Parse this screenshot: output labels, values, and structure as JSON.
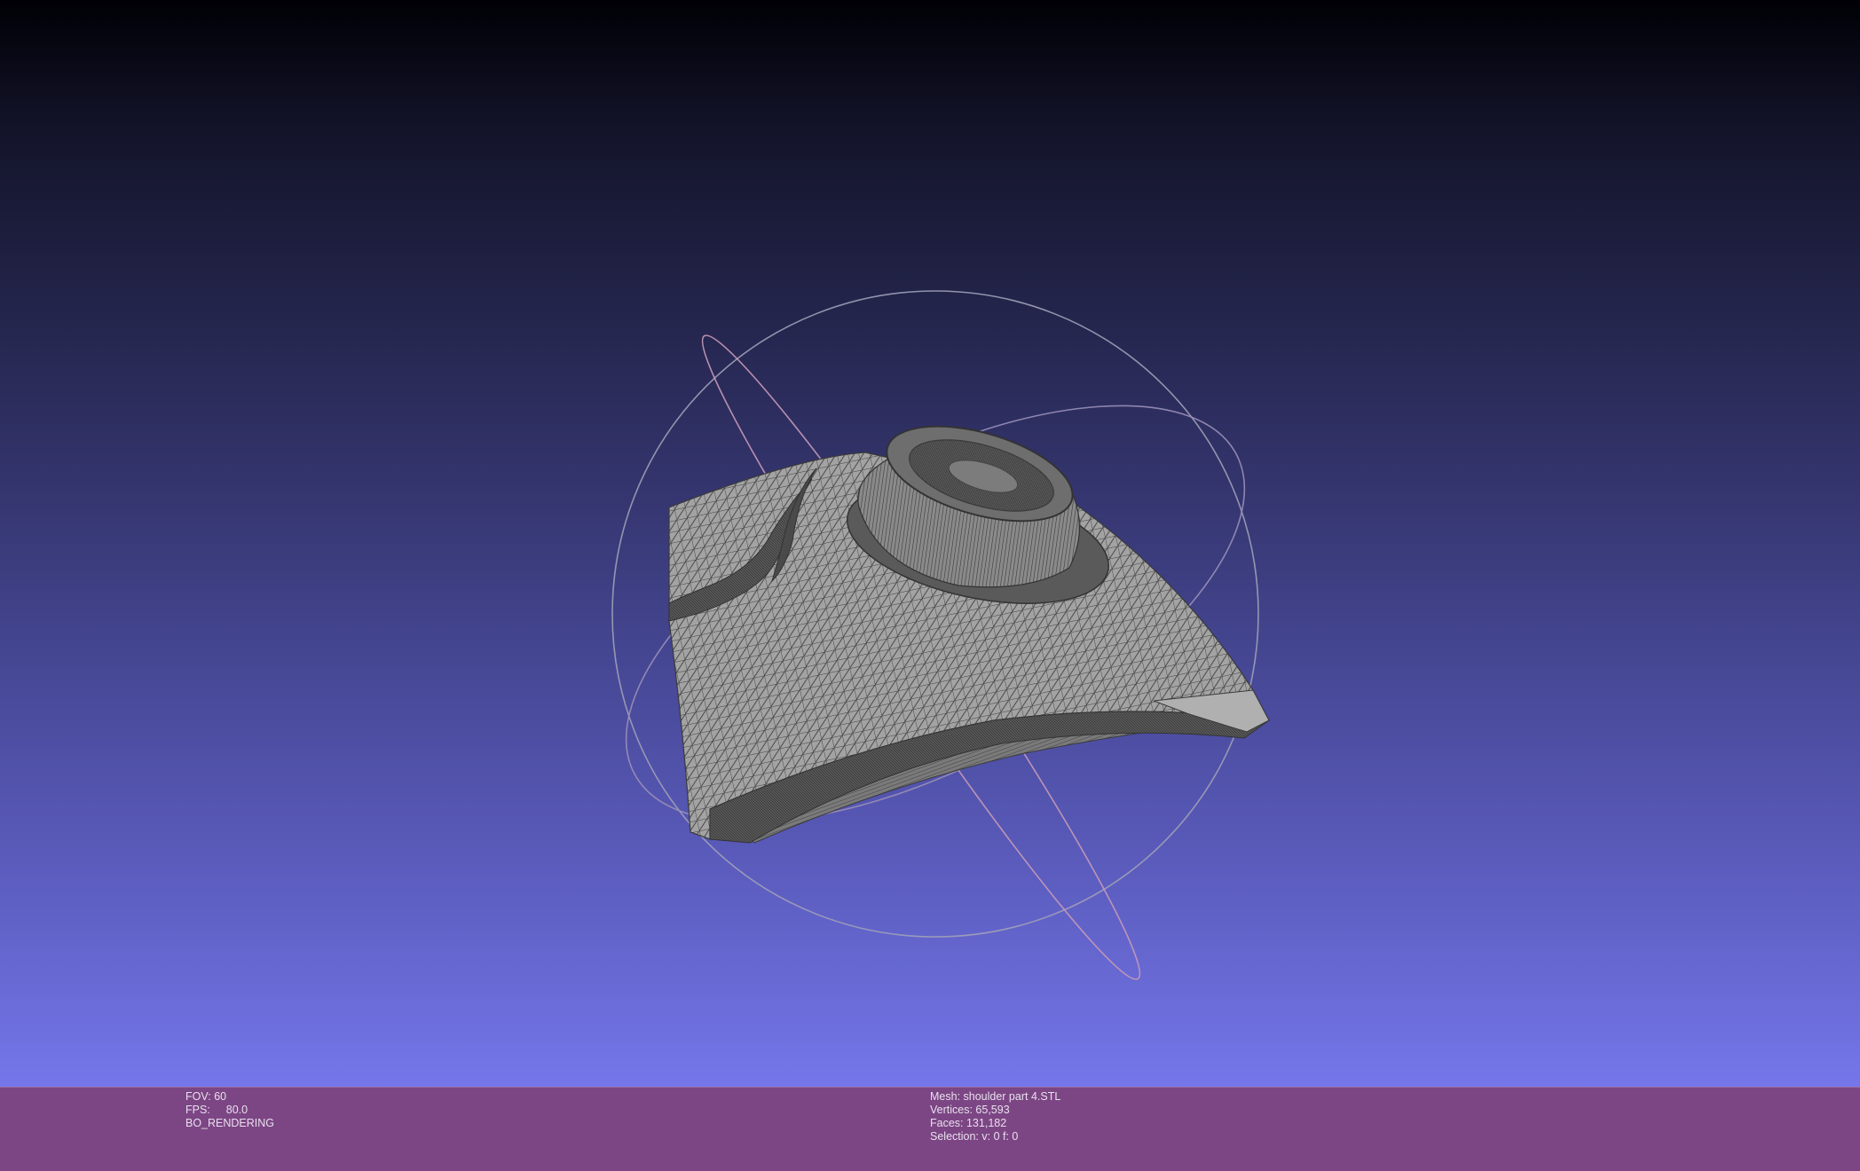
{
  "viewport": {
    "background_top": "#000005",
    "background_bottom": "#7576ea",
    "mesh_color": "#9c9c9c",
    "wire_color": "#3c3c3c",
    "trackball_colors": [
      "#9a8fb8",
      "#c89ab8",
      "#a0a0b8"
    ]
  },
  "infobar": {
    "background": "#7c4684",
    "left": {
      "fov_label": "FOV:",
      "fov_value": "60",
      "fps_label": "FPS:",
      "fps_value": "80.0",
      "render_mode": "BO_RENDERING"
    },
    "right": {
      "mesh": "Mesh: shoulder part 4.STL",
      "vertices": "Vertices: 65,593",
      "faces": "Faces: 131,182",
      "selection": "Selection: v: 0 f: 0"
    }
  }
}
